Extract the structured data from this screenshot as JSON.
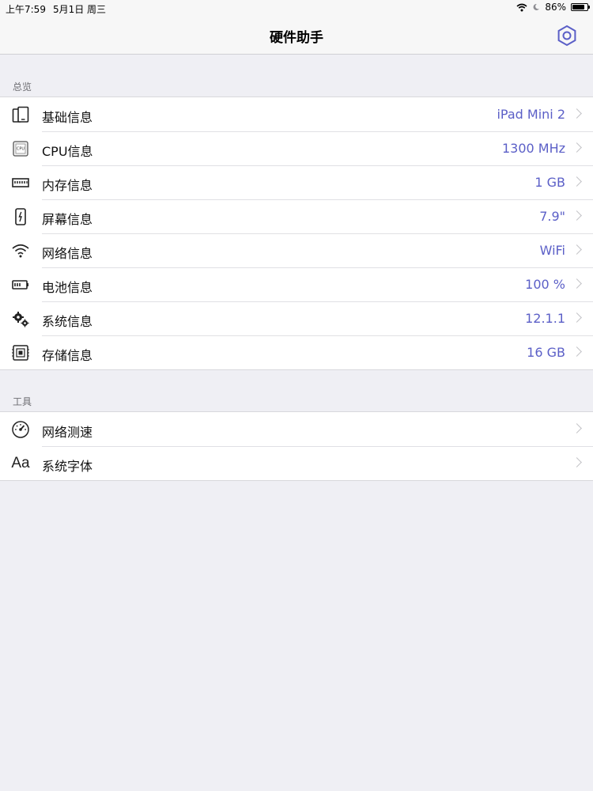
{
  "status_bar": {
    "time": "上午7:59",
    "date": "5月1日 周三",
    "battery_text": "86%",
    "battery_level": 0.86
  },
  "nav": {
    "title": "硬件助手"
  },
  "overview": {
    "header": "总览",
    "items": [
      {
        "icon": "device-icon",
        "label": "基础信息",
        "value": "iPad Mini 2"
      },
      {
        "icon": "cpu-icon",
        "label": "CPU信息",
        "value": "1300 MHz"
      },
      {
        "icon": "memory-icon",
        "label": "内存信息",
        "value": "1 GB"
      },
      {
        "icon": "screen-icon",
        "label": "屏幕信息",
        "value": "7.9\""
      },
      {
        "icon": "wifi-icon",
        "label": "网络信息",
        "value": "WiFi"
      },
      {
        "icon": "battery-icon",
        "label": "电池信息",
        "value": "100 %"
      },
      {
        "icon": "gears-icon",
        "label": "系统信息",
        "value": "12.1.1"
      },
      {
        "icon": "storage-icon",
        "label": "存储信息",
        "value": "16 GB"
      }
    ]
  },
  "tools": {
    "header": "工具",
    "items": [
      {
        "icon": "speedometer-icon",
        "label": "网络测速"
      },
      {
        "icon": "font-icon",
        "label": "系统字体",
        "glyph": "Aa"
      }
    ]
  },
  "colors": {
    "accent": "#5b5fc7",
    "background": "#efeff4"
  }
}
